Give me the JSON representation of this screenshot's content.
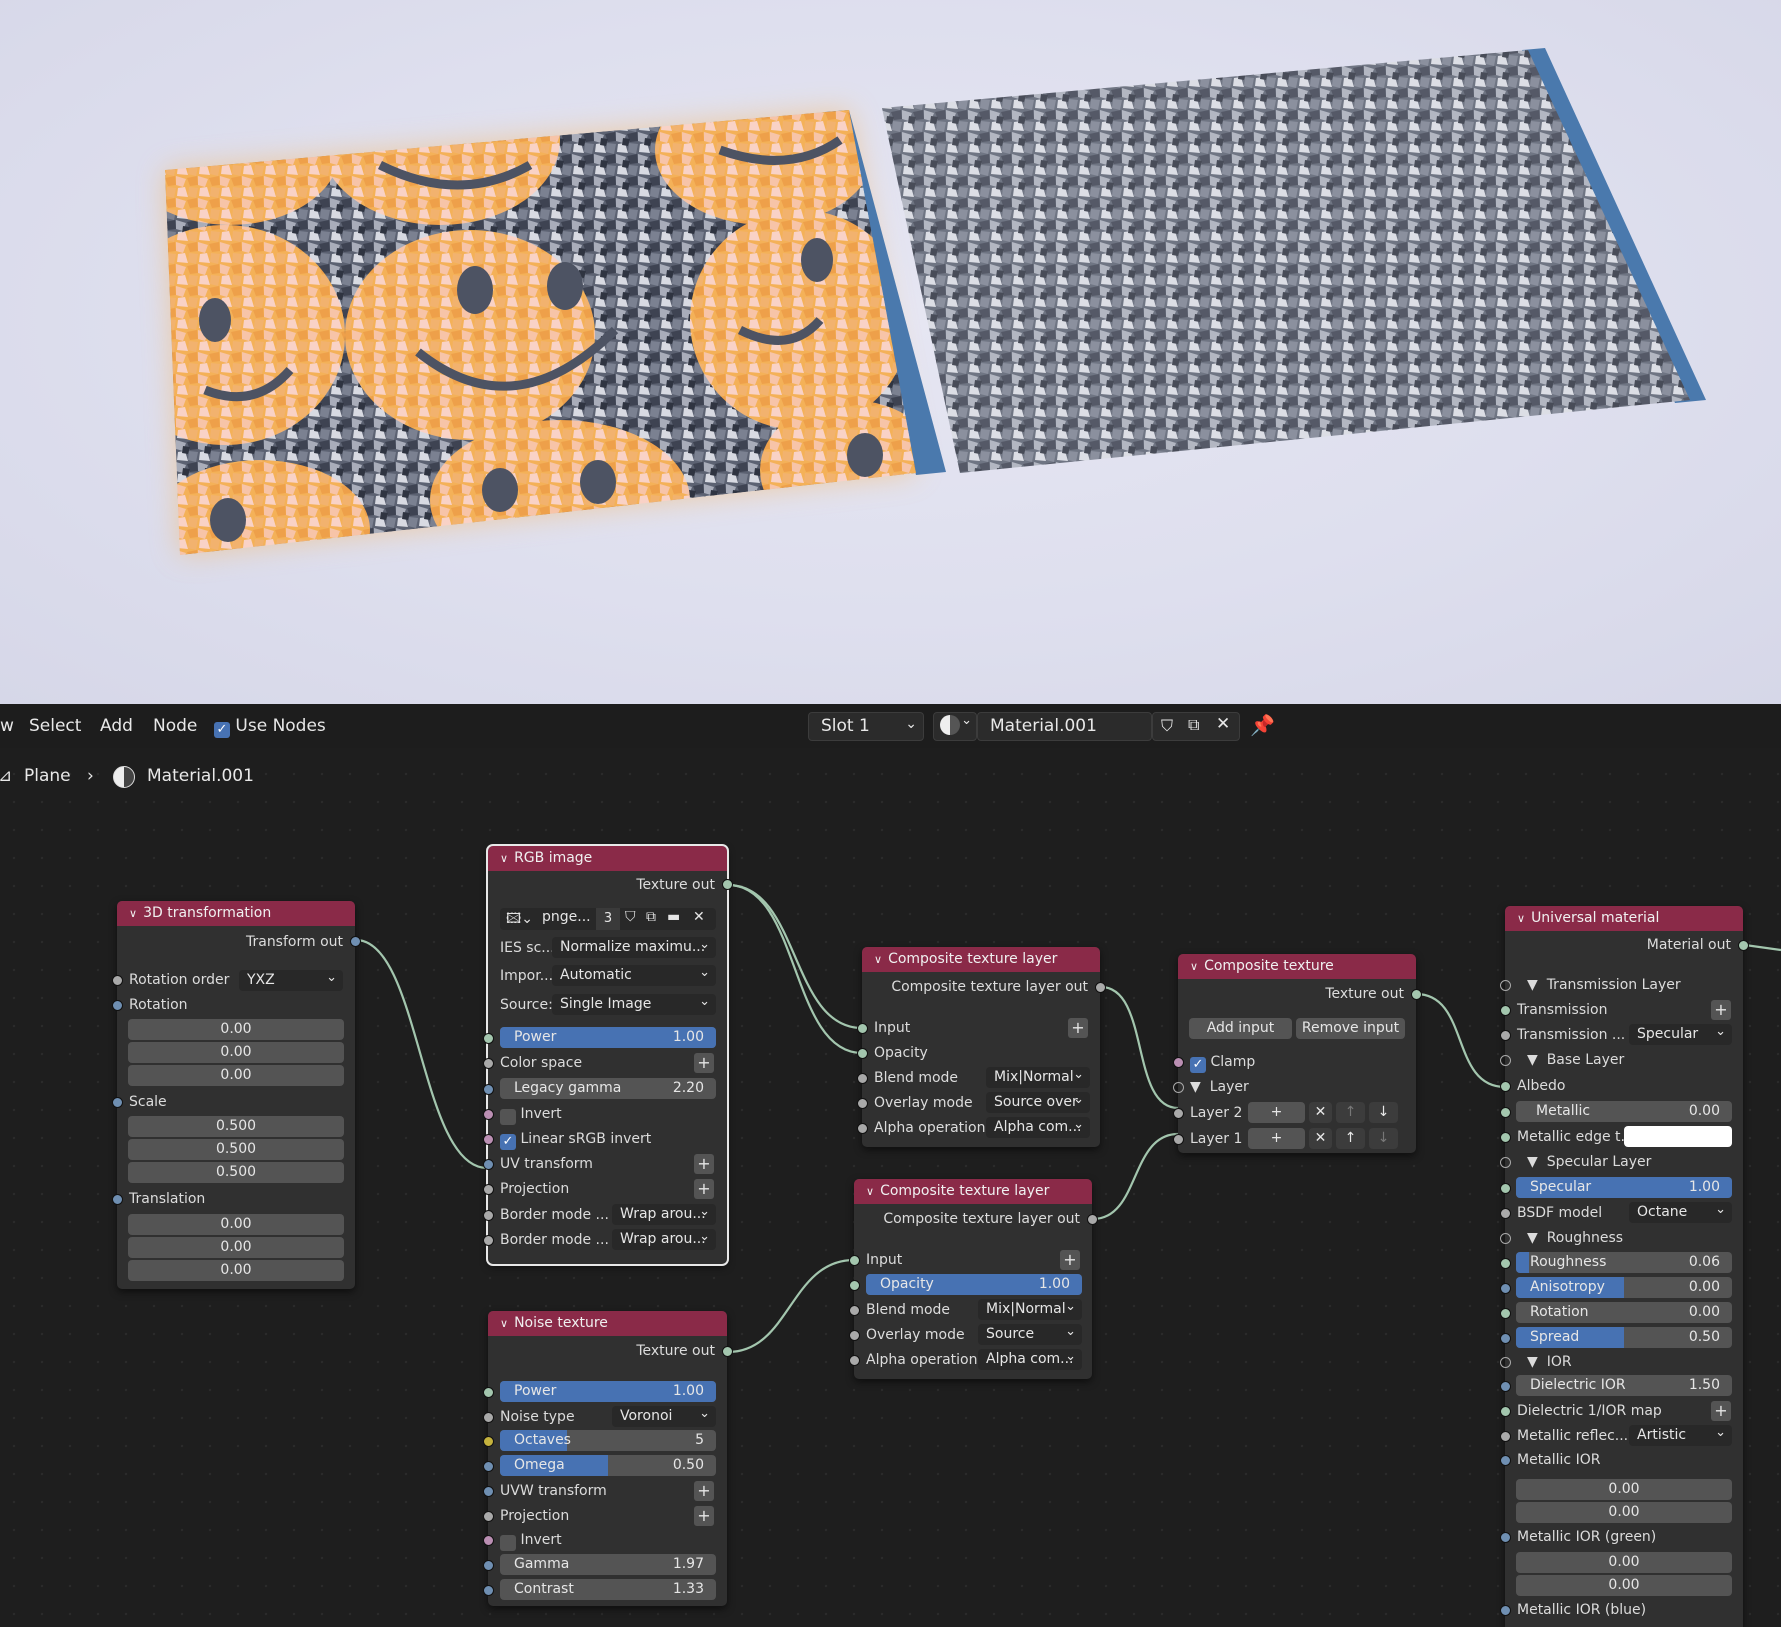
{
  "header": {
    "menu": [
      "w",
      "Select",
      "Add",
      "Node"
    ],
    "use_nodes_label": "Use Nodes",
    "slot": "Slot 1",
    "material_name": "Material.001",
    "breadcrumb_object": "Plane",
    "breadcrumb_material": "Material.001"
  },
  "nodes": {
    "transform": {
      "title": "3D transformation",
      "out": "Transform out",
      "rotation_order_label": "Rotation order",
      "rotation_order": "YXZ",
      "rotation_label": "Rotation",
      "rotation": [
        "0.00",
        "0.00",
        "0.00"
      ],
      "scale_label": "Scale",
      "scale": [
        "0.500",
        "0.500",
        "0.500"
      ],
      "translation_label": "Translation",
      "translation": [
        "0.00",
        "0.00",
        "0.00"
      ]
    },
    "rgb": {
      "title": "RGB image",
      "out": "Texture out",
      "image_name": "pnge...",
      "users": "3",
      "ies_label": "IES sc...",
      "ies_value": "Normalize maximu...",
      "import_label": "Impor...",
      "import_value": "Automatic",
      "source_label": "Source:",
      "source_value": "Single Image",
      "power_label": "Power",
      "power_value": "1.00",
      "color_space": "Color space",
      "legacy_gamma_label": "Legacy gamma",
      "legacy_gamma_value": "2.20",
      "invert": "Invert",
      "linear_srgb_invert": "Linear sRGB invert",
      "uv_transform": "UV transform",
      "projection": "Projection",
      "border_u_label": "Border mode ...",
      "border_u_value": "Wrap arou...",
      "border_v_label": "Border mode ...",
      "border_v_value": "Wrap arou..."
    },
    "noise": {
      "title": "Noise texture",
      "out": "Texture out",
      "power_label": "Power",
      "power_value": "1.00",
      "noise_type_label": "Noise type",
      "noise_type_value": "Voronoi",
      "octaves_label": "Octaves",
      "octaves_value": "5",
      "omega_label": "Omega",
      "omega_value": "0.50",
      "uvw_transform": "UVW transform",
      "projection": "Projection",
      "invert": "Invert",
      "gamma_label": "Gamma",
      "gamma_value": "1.97",
      "contrast_label": "Contrast",
      "contrast_value": "1.33"
    },
    "ctl1": {
      "title": "Composite texture layer",
      "out": "Composite texture layer out",
      "input": "Input",
      "opacity": "Opacity",
      "blend_label": "Blend mode",
      "blend_value": "Mix|Normal",
      "overlay_label": "Overlay mode",
      "overlay_value": "Source over",
      "alpha_label": "Alpha operation",
      "alpha_value": "Alpha com..."
    },
    "ctl2": {
      "title": "Composite texture layer",
      "out": "Composite texture layer out",
      "input": "Input",
      "opacity_label": "Opacity",
      "opacity_value": "1.00",
      "blend_label": "Blend mode",
      "blend_value": "Mix|Normal",
      "overlay_label": "Overlay mode",
      "overlay_value": "Source",
      "alpha_label": "Alpha operation",
      "alpha_value": "Alpha com..."
    },
    "composite": {
      "title": "Composite texture",
      "out": "Texture out",
      "add_input": "Add input",
      "remove_input": "Remove input",
      "clamp": "Clamp",
      "layer_header": "Layer",
      "layer2": "Layer 2",
      "layer1": "Layer 1"
    },
    "universal": {
      "title": "Universal material",
      "out": "Material out",
      "transmission_layer": "Transmission Layer",
      "transmission": "Transmission",
      "transmission_type_label": "Transmission ...",
      "transmission_type_value": "Specular",
      "base_layer": "Base Layer",
      "albedo": "Albedo",
      "metallic_label": "Metallic",
      "metallic_value": "0.00",
      "metallic_edge_label": "Metallic edge t...",
      "specular_layer": "Specular Layer",
      "specular_label": "Specular",
      "specular_value": "1.00",
      "bsdf_label": "BSDF model",
      "bsdf_value": "Octane",
      "roughness_header": "Roughness",
      "roughness_label": "Roughness",
      "roughness_value": "0.06",
      "anisotropy_label": "Anisotropy",
      "anisotropy_value": "0.00",
      "rotation_label": "Rotation",
      "rotation_value": "0.00",
      "spread_label": "Spread",
      "spread_value": "0.50",
      "ior_header": "IOR",
      "dielectric_ior_label": "Dielectric IOR",
      "dielectric_ior_value": "1.50",
      "dielectric_map": "Dielectric 1/IOR map",
      "metallic_reflect_label": "Metallic reflec...",
      "metallic_reflect_value": "Artistic",
      "metallic_ior": "Metallic IOR",
      "metallic_ior_values": [
        "0.00",
        "0.00"
      ],
      "metallic_ior_green": "Metallic IOR (green)",
      "metallic_ior_green_values": [
        "0.00",
        "0.00"
      ],
      "metallic_ior_blue": "Metallic IOR (blue)"
    }
  },
  "colors": {
    "node_header": "#8a2a48",
    "accent_blue": "#4772b3",
    "link": "#a3c6ae"
  }
}
